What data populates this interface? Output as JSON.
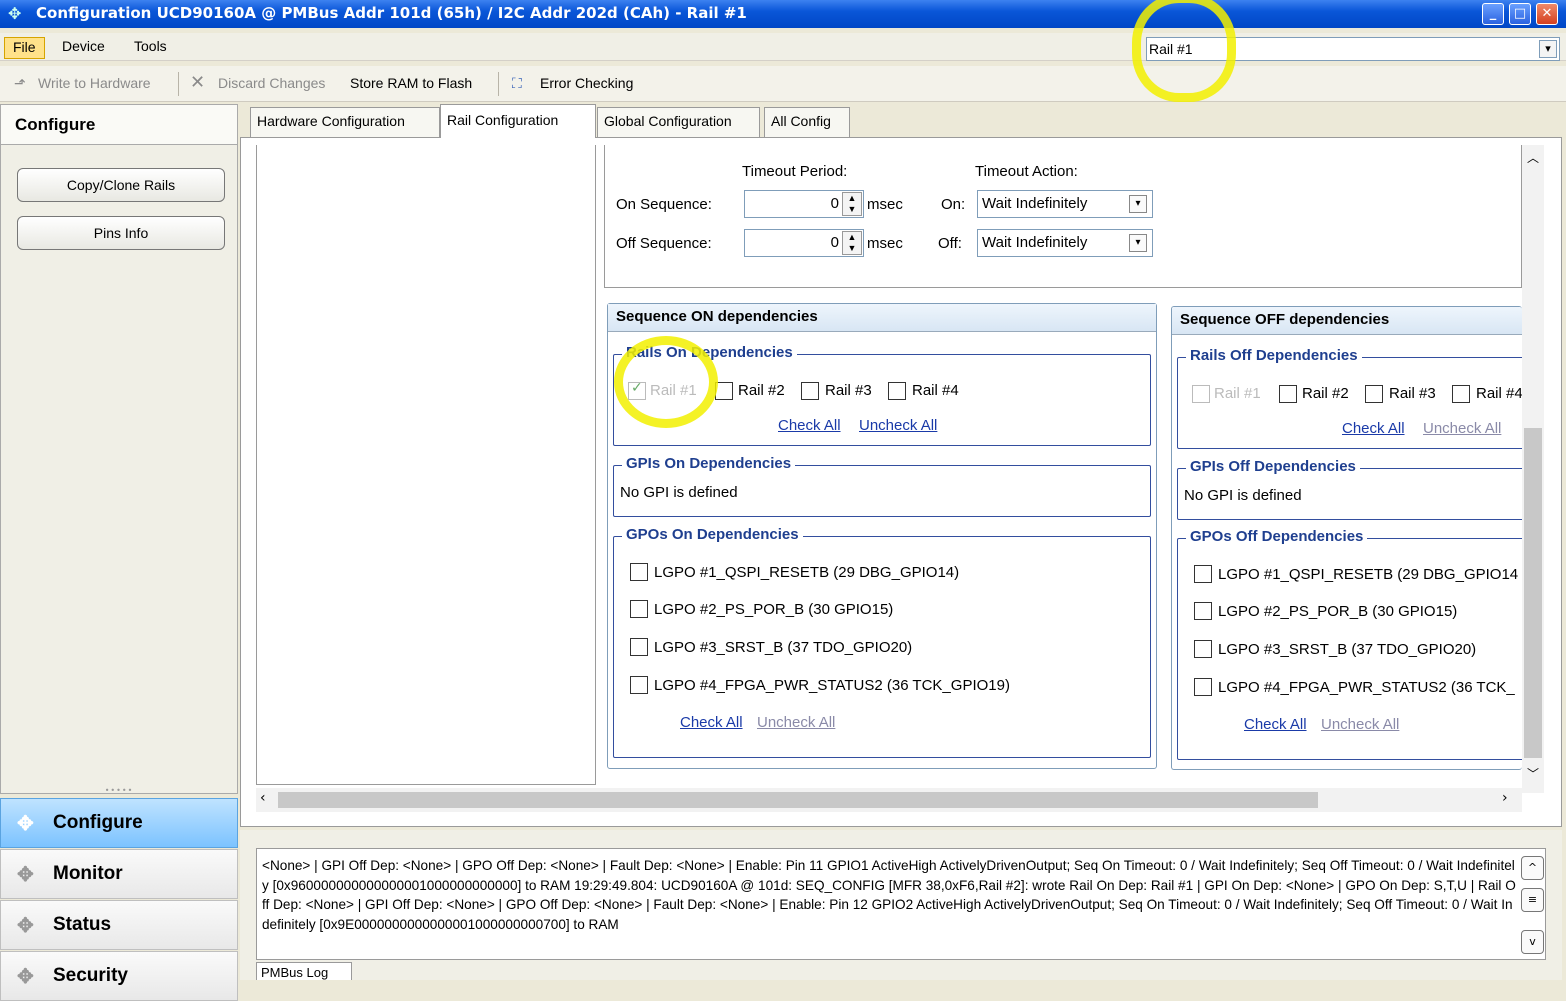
{
  "window": {
    "title": "Configuration UCD90160A @ PMBus Addr 101d (65h) / I2C Addr 202d (CAh)  - Rail #1"
  },
  "menu": {
    "file": "File",
    "device": "Device",
    "tools": "Tools"
  },
  "rail_selector": {
    "value": "Rail #1"
  },
  "toolbar": {
    "write": "Write to Hardware",
    "discard": "Discard Changes",
    "store": "Store RAM to Flash",
    "error": "Error Checking"
  },
  "left": {
    "header": "Configure",
    "copy_clone": "Copy/Clone Rails",
    "pins_info": "Pins Info",
    "nav": [
      "Configure",
      "Monitor",
      "Status",
      "Security"
    ]
  },
  "tabs": [
    "Hardware Configuration",
    "Rail Configuration",
    "Global Configuration",
    "All Config"
  ],
  "timeout": {
    "period_header": "Timeout Period:",
    "action_header": "Timeout Action:",
    "on_label": "On Sequence:",
    "off_label": "Off Sequence:",
    "on_value": "0",
    "off_value": "0",
    "unit": "msec",
    "on_action_label": "On:",
    "off_action_label": "Off:",
    "on_action": "Wait Indefinitely",
    "off_action": "Wait Indefinitely"
  },
  "seq_on": {
    "title": "Sequence ON dependencies",
    "rails_title": "Rails On Dependencies",
    "rails": [
      "Rail #1",
      "Rail #2",
      "Rail #3",
      "Rail #4"
    ],
    "check_all": "Check All",
    "uncheck_all": "Uncheck All",
    "gpis_title": "GPIs On Dependencies",
    "gpis_text": "No GPI is defined",
    "gpos_title": "GPOs On Dependencies",
    "gpos": [
      "LGPO #1_QSPI_RESETB (29 DBG_GPIO14)",
      "LGPO #2_PS_POR_B (30 GPIO15)",
      "LGPO #3_SRST_B (37 TDO_GPIO20)",
      "LGPO #4_FPGA_PWR_STATUS2 (36 TCK_GPIO19)"
    ]
  },
  "seq_off": {
    "title": "Sequence OFF dependencies",
    "rails_title": "Rails Off Dependencies",
    "rails": [
      "Rail #1",
      "Rail #2",
      "Rail #3",
      "Rail #4"
    ],
    "check_all": "Check All",
    "uncheck_all": "Uncheck All",
    "gpis_title": "GPIs Off Dependencies",
    "gpis_text": "No GPI is defined",
    "gpos_title": "GPOs Off Dependencies",
    "gpos": [
      "LGPO #1_QSPI_RESETB (29 DBG_GPIO14",
      "LGPO #2_PS_POR_B (30 GPIO15)",
      "LGPO #3_SRST_B (37 TDO_GPIO20)",
      "LGPO #4_FPGA_PWR_STATUS2 (36 TCK_"
    ]
  },
  "log": {
    "text": "<None> | GPI Off Dep: <None> | GPO Off Dep: <None> | Fault Dep: <None> | Enable: Pin 11 GPIO1 ActiveHigh ActivelyDrivenOutput; Seq On Timeout: 0 / Wait Indefinitely; Seq Off Timeout: 0 / Wait Indefinitely [0x960000000000000001000000000000] to RAM 19:29:49.804: UCD90160A @ 101d: SEQ_CONFIG [MFR 38,0xF6,Rail #2]: wrote Rail On Dep: Rail #1 | GPI On Dep: <None> | GPO On Dep: S,T,U | Rail Off Dep: <None> | GPI Off Dep: <None> | GPO Off Dep: <None> | Fault Dep: <None> | Enable: Pin 12 GPIO2 ActiveHigh ActivelyDrivenOutput; Seq On Timeout: 0 / Wait Indefinitely; Seq Off Timeout: 0 / Wait Indefinitely [0x9E0000000000000001000000000700] to RAM",
    "tab": "PMBus Log"
  },
  "colors": {
    "highlight": "#f2f000",
    "link": "#1a3aa8",
    "group_title": "#1f3f8f",
    "nav_active": "#7cc3ff"
  }
}
